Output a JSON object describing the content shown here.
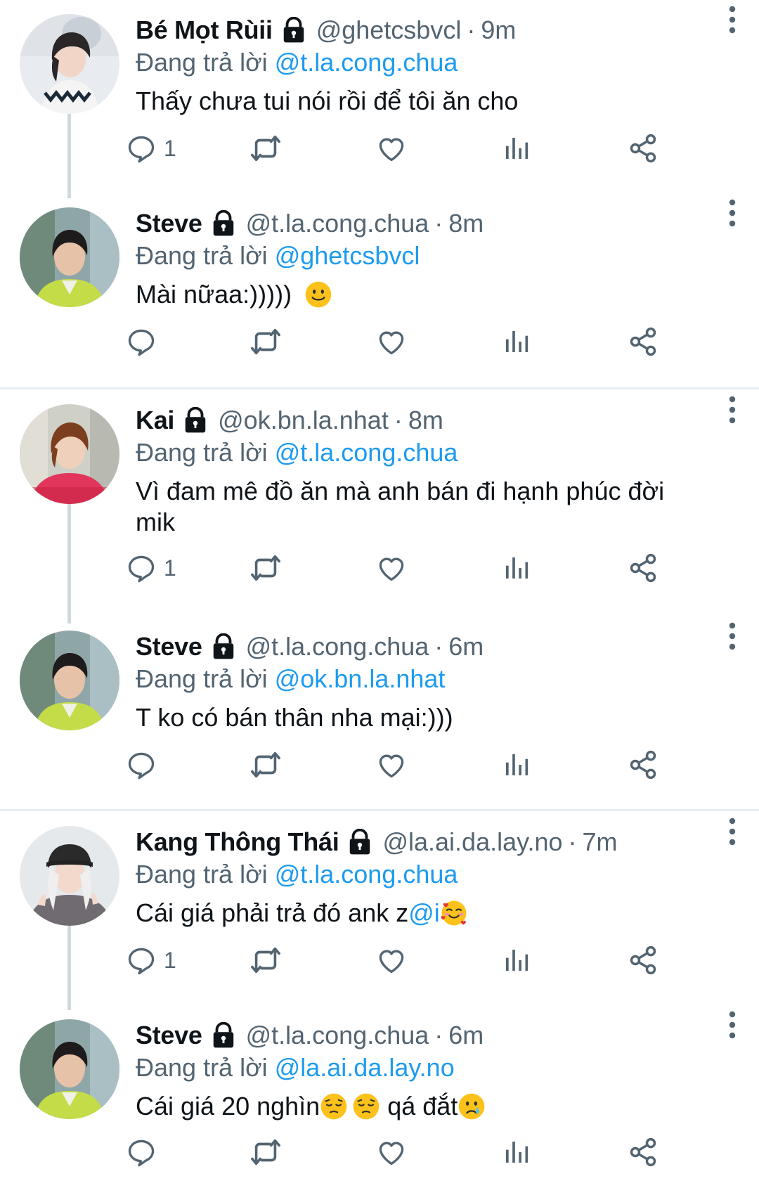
{
  "reply_prefix": "Đang trả lời",
  "colors": {
    "mention": "#1d9bf0",
    "secondary": "#536471",
    "separator": "#e7ecf0"
  },
  "tweets": [
    {
      "name": "Bé Mọt Rùii",
      "handle": "@ghetcsbvcl",
      "time": "9m",
      "reply_to": "@t.la.cong.chua",
      "text": "Thấy chưa tui nói rồi để tôi ăn cho",
      "reply_count": "1",
      "avatar": "avatar-bemot"
    },
    {
      "name": "Steve",
      "handle": "@t.la.cong.chua",
      "time": "8m",
      "reply_to": "@ghetcsbvcl",
      "text": "Mài nữaa:)))))",
      "emoji_after": "slightly-smiling-face",
      "reply_count": "",
      "avatar": "avatar-steve"
    },
    {
      "name": "Kai",
      "handle": "@ok.bn.la.nhat",
      "time": "8m",
      "reply_to": "@t.la.cong.chua",
      "text_line1": "Vì đam mê đồ ăn mà anh bán đi hạnh phúc đời",
      "text_line2": "mik",
      "reply_count": "1",
      "avatar": "avatar-kai"
    },
    {
      "name": "Steve",
      "handle": "@t.la.cong.chua",
      "time": "6m",
      "reply_to": "@ok.bn.la.nhat",
      "text": "T ko có bán thân nha mại:)))",
      "reply_count": "",
      "avatar": "avatar-steve"
    },
    {
      "name": "Kang Thông Thái",
      "handle": "@la.ai.da.lay.no",
      "time": "7m",
      "reply_to": "@t.la.cong.chua",
      "text": "Cái giá phải trả đó ank z",
      "text_mention": "@i",
      "emoji_after": "smiling-face-with-hearts",
      "reply_count": "1",
      "avatar": "avatar-kang"
    },
    {
      "name": "Steve",
      "handle": "@t.la.cong.chua",
      "time": "6m",
      "reply_to": "@la.ai.da.lay.no",
      "text_part1": "Cái giá 20 nghìn",
      "text_part2": " qá đắt",
      "emojis": [
        "pensive-face",
        "pensive-face",
        "crying-face"
      ],
      "reply_count": "",
      "avatar": "avatar-steve"
    }
  ]
}
